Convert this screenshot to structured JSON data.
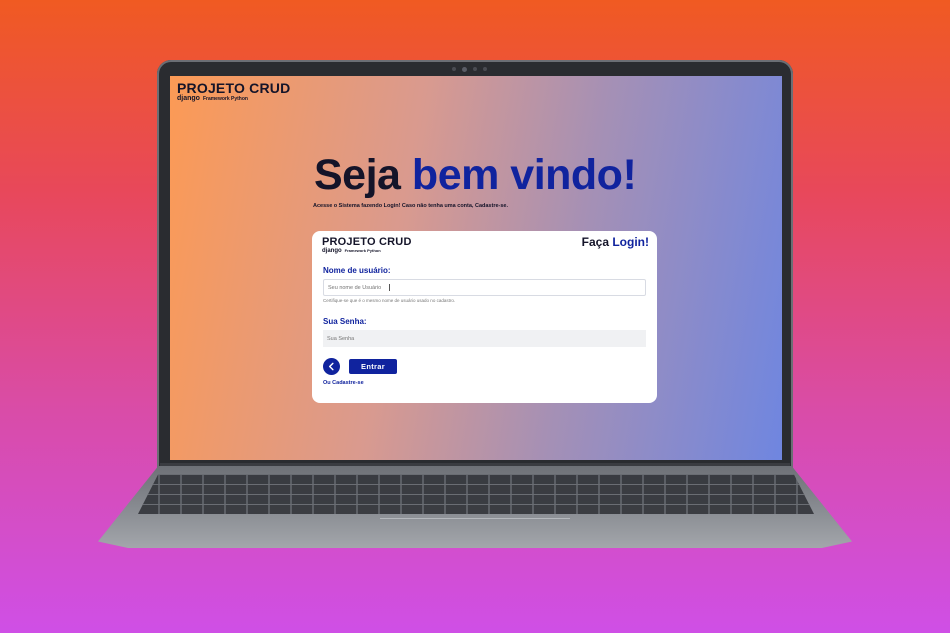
{
  "colors": {
    "background_top": "#f05a22",
    "background_bottom": "#cf4fe6",
    "primary_blue": "#10239e",
    "dark_text": "#141429",
    "screen_gradient_left": "#fc9a55",
    "screen_gradient_right": "#6f86e0"
  },
  "app": {
    "brand_title": "PROJETO CRUD",
    "brand_django": "django",
    "brand_framework": "Framework Python"
  },
  "hero": {
    "title_part1": "Seja",
    "title_part2": "bem vindo!",
    "description": "Acesse o Sistema fazendo Login! Caso não tenha uma conta, Cadastre-se."
  },
  "login_card": {
    "brand_title": "PROJETO CRUD",
    "brand_django": "django",
    "brand_framework": "Framework Python",
    "heading_part1": "Faça",
    "heading_part2": "Login!",
    "username_label": "Nome de usuário:",
    "username_placeholder": "Seu nome de Usuário",
    "username_hint": "Certifique-se que é o mesmo nome de usuário usado no cadastro.",
    "password_label": "Sua Senha:",
    "password_placeholder": "Sua Senha",
    "back_icon": "chevron-left-icon",
    "submit_label": "Entrar",
    "signup_link": "Ou Cadastre-se"
  }
}
